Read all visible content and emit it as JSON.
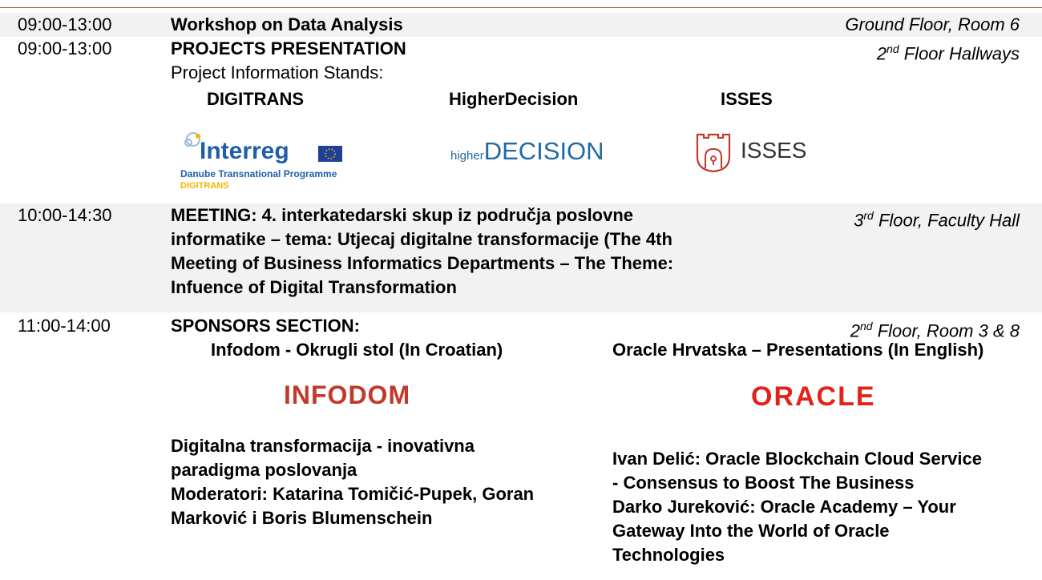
{
  "events": [
    {
      "time": "09:00-13:00",
      "title": "Workshop on Data Analysis",
      "location": "Ground Floor, Room 6"
    },
    {
      "time": "09:00-13:00",
      "title": "PROJECTS PRESENTATION",
      "location_pre": "2",
      "location_sup": "nd",
      "location_post": " Floor Hallways",
      "subtitle": "Project Information Stands:",
      "stands": [
        "DIGITRANS",
        "HigherDecision",
        "ISSES"
      ]
    },
    {
      "time": "10:00-14:30",
      "title_lines": [
        "MEETING: 4. interkatedarski skup iz područja poslovne",
        "informatike – tema: Utjecaj digitalne transformacije (The 4th",
        "Meeting of Business Informatics Departments – The Theme:",
        "Infuence of Digital Transformation"
      ],
      "location_pre": "3",
      "location_sup": "rd",
      "location_post": " Floor, Faculty Hall"
    },
    {
      "time": "11:00-14:00",
      "title": "SPONSORS SECTION:",
      "location_pre": "2",
      "location_sup": "nd",
      "location_post": " Floor, Room 3 & 8",
      "sponsors": [
        {
          "heading": "Infodom - Okrugli stol (In Croatian)",
          "logo": "INFODOM",
          "lines": [
            "Digitalna transformacija - inovativna",
            "paradigma poslovanja",
            "Moderatori: Katarina Tomičić-Pupek, Goran",
            "Marković i Boris Blumenschein"
          ]
        },
        {
          "heading": "Oracle Hrvatska – Presentations (In English)",
          "logo": "ORACLE",
          "lines": [
            "Ivan Delić: Oracle Blockchain Cloud Service",
            "- Consensus to Boost The Business",
            "Darko Jureković: Oracle Academy – Your",
            "Gateway Into the World of Oracle",
            "Technologies"
          ]
        }
      ]
    }
  ],
  "logos": {
    "interreg": {
      "name": "Interreg",
      "sub": "Danube Transnational Programme",
      "project": "DIGITRANS",
      "brand_color": "#1f5fa8",
      "accent": "#f2b600"
    },
    "higherdecision": {
      "prefix": "higher",
      "main": "DECISION",
      "color": "#1f6aa5"
    },
    "isses": {
      "text": "ISSES",
      "color": "#c0392b"
    },
    "infodom_color": "#c0392b",
    "oracle_color": "#e2231a"
  }
}
